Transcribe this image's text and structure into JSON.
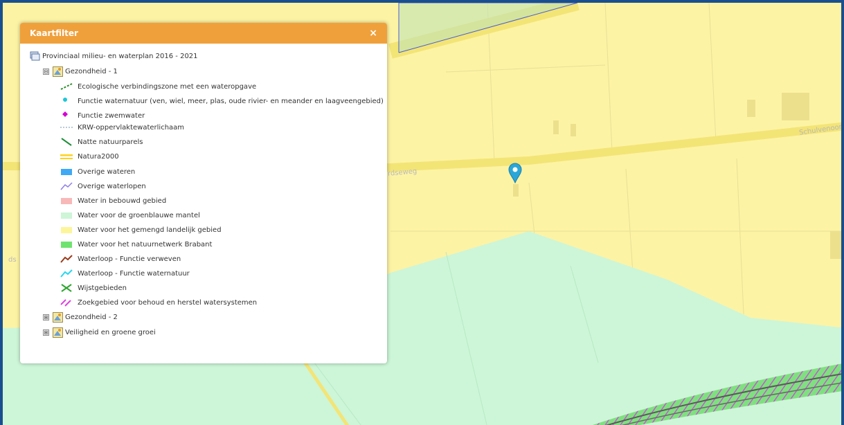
{
  "panel": {
    "title": "Kaartfilter",
    "close_label": "×",
    "root": {
      "label": "Provinciaal milieu- en waterplan 2016 - 2021",
      "icon": "map-stack-icon"
    },
    "groups": [
      {
        "label": "Gezondheid - 1",
        "expanded": true,
        "toggle": "⊟",
        "items": [
          {
            "label": "Ecologische verbindingszone met een wateropgave",
            "color": "#2a8f2a",
            "icon": "dashed-green-line-icon"
          },
          {
            "label": "Functie waternatuur (ven, wiel, meer, plas, oude rivier- en meander en laagveengebied)",
            "color": "#1ec6d6",
            "icon": "cyan-dot-icon"
          },
          {
            "label": "Functie zwemwater",
            "color": "#d400d4",
            "icon": "magenta-diamond-icon"
          },
          {
            "label": "KRW-oppervlaktewaterlichaam",
            "color": "#9fb8c8",
            "icon": "dashed-grey-line-icon"
          },
          {
            "label": "Natte natuurparels",
            "color": "#1f8f3a",
            "icon": "green-diagonal-line-icon"
          },
          {
            "label": "Natura2000",
            "color": "#ffd21e",
            "icon": "yellow-lines-icon"
          },
          {
            "label": "Overige wateren",
            "color": "#3fa9f5",
            "icon": "blue-swatch-icon"
          },
          {
            "label": "Overige waterlopen",
            "color": "#8f7fe8",
            "icon": "purple-line-icon"
          },
          {
            "label": "Water in bebouwd gebied",
            "color": "#f8b8b8",
            "icon": "pink-swatch-icon"
          },
          {
            "label": "Water voor de groenblauwe mantel",
            "color": "#cdf5d6",
            "icon": "light-green-swatch-icon"
          },
          {
            "label": "Water voor het gemengd landelijk gebied",
            "color": "#fdf59a",
            "icon": "light-yellow-swatch-icon"
          },
          {
            "label": "Water voor het natuurnetwerk Brabant",
            "color": "#6fe36f",
            "icon": "green-swatch-icon"
          },
          {
            "label": "Waterloop - Functie verweven",
            "color": "#9a3a1a",
            "icon": "brown-line-icon"
          },
          {
            "label": "Waterloop - Functie waternatuur",
            "color": "#28d6f0",
            "icon": "cyan-line-icon"
          },
          {
            "label": "Wijstgebieden",
            "color": "#2fa52f",
            "icon": "green-cross-icon"
          },
          {
            "label": "Zoekgebied voor behoud en herstel watersystemen",
            "color": "#e040e0",
            "icon": "magenta-hatch-icon"
          }
        ]
      },
      {
        "label": "Gezondheid - 2",
        "expanded": false,
        "toggle": "⊞"
      },
      {
        "label": "Veiligheid en groene groei",
        "expanded": false,
        "toggle": "⊞"
      }
    ]
  },
  "map": {
    "street_labels": [
      {
        "label": "Schulvenoord"
      },
      {
        "label": "rdseweg"
      },
      {
        "label": "ds"
      }
    ],
    "marker": "location-pin-icon",
    "colors": {
      "yellow": "#fdf3a4",
      "road": "#f3e476",
      "mint": "#cdf6d8",
      "green": "#7fe07f",
      "hatch": "#d040e0",
      "border": "#1a4f8f"
    }
  }
}
